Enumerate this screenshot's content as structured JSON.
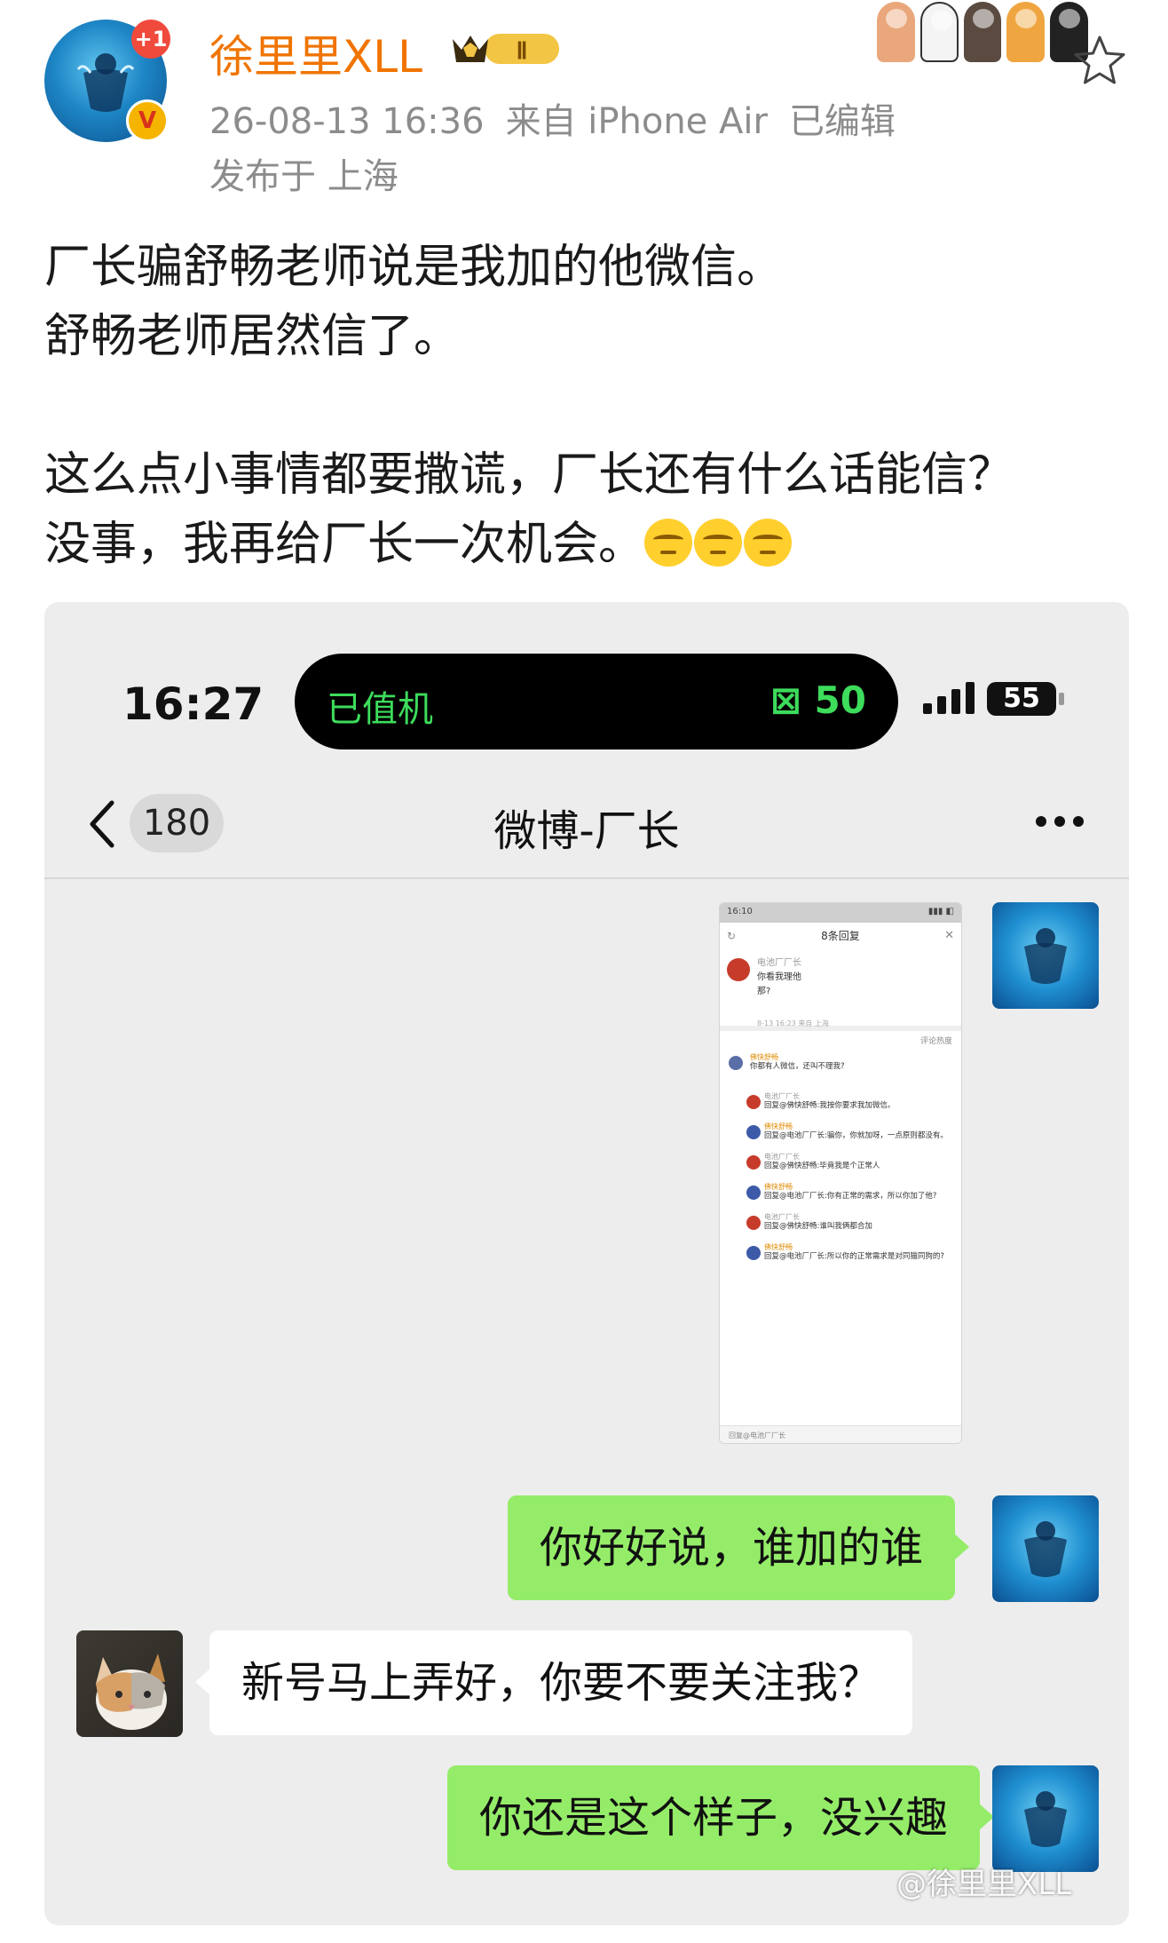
{
  "post": {
    "username": "徐里里XLL",
    "level_badge": "Ⅱ",
    "notification_count": "+1",
    "verified_mark": "V",
    "timestamp": "26-08-13 16:36",
    "source": "来自 iPhone Air",
    "edited": "已编辑",
    "location": "发布于 上海",
    "text_lines": [
      "厂长骗舒畅老师说是我加的他微信。",
      "舒畅老师居然信了。",
      "",
      "这么点小事情都要撒谎，厂长还有什么话能信？",
      "没事，我再给厂长一次机会。"
    ],
    "emoji_name": "think-face-icon",
    "watermark": "@徐里里XLL"
  },
  "chat_screenshot": {
    "status_time": "16:27",
    "island_left": "已值机",
    "island_right": "⊠ 50",
    "battery": "55",
    "back_count": "180",
    "title": "微博-厂长",
    "messages": [
      {
        "from": "me",
        "type": "image"
      },
      {
        "from": "me",
        "text": "你好好说，谁加的谁"
      },
      {
        "from": "them",
        "text": "新号马上弄好，你要不要关注我？"
      },
      {
        "from": "me",
        "text": "你还是这个样子，没兴趣"
      }
    ],
    "nested": {
      "status_time": "16:10",
      "header": "8条回复",
      "top_name": "电池厂厂长",
      "top_text_1": "你看我理他",
      "top_text_2": "那?",
      "top_foot": "8-13 16:23  来自 上海",
      "sort": "评论热度",
      "comments": [
        {
          "kind": "top",
          "name": "佛快舒畅",
          "text": "你都有人微信，还叫不理我?"
        },
        {
          "kind": "r-red",
          "name": "电池厂厂长",
          "text": "回复@佛快舒畅:我按你要求我加微信。"
        },
        {
          "kind": "r-blue",
          "name": "佛快舒畅",
          "text": "回复@电池厂厂长:骗你，你就加呀，一点原则都没有。"
        },
        {
          "kind": "r-red",
          "name": "电池厂厂长",
          "text": "回复@佛快舒畅:毕竟我是个正常人"
        },
        {
          "kind": "r-blue",
          "name": "佛快舒畅",
          "text": "回复@电池厂厂长:你有正常的需求，所以你加了他?"
        },
        {
          "kind": "r-red",
          "name": "电池厂厂长",
          "text": "回复@佛快舒畅:谁叫我俩都合加"
        },
        {
          "kind": "r-blue",
          "name": "佛快舒畅",
          "text": "回复@电池厂厂长:所以你的正常需求是对同猫同狗的?"
        }
      ],
      "footer": "回复@电池厂厂长"
    }
  },
  "colors": {
    "username": "#f07400",
    "bubble_me": "#95ec69",
    "bubble_them": "#ffffff",
    "island_text": "#3ddc5b"
  }
}
